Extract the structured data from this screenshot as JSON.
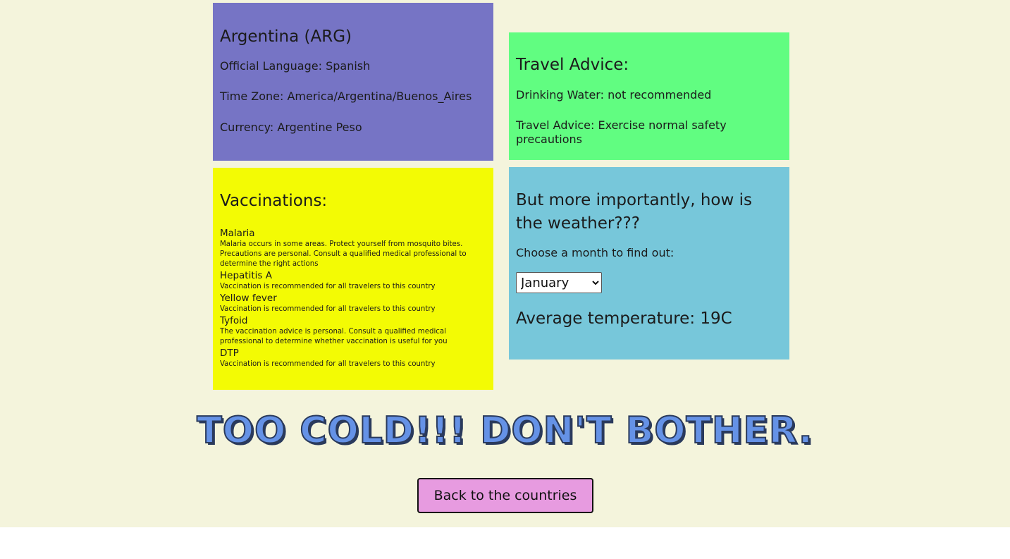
{
  "country": {
    "title": "Argentina (ARG)",
    "language": "Official Language: Spanish",
    "timezone": "Time Zone: America/Argentina/Buenos_Aires",
    "currency": "Currency: Argentine Peso"
  },
  "advice": {
    "heading": "Travel Advice:",
    "drinking_water": "Drinking Water: not recommended",
    "travel_advice": "Travel Advice: Exercise normal safety precautions"
  },
  "vaccinations": {
    "heading": "Vaccinations:",
    "items": [
      {
        "name": "Malaria",
        "description": "Malaria occurs in some areas. Protect yourself from mosquito bites. Precautions are personal. Consult a qualified medical professional to determine the right actions"
      },
      {
        "name": "Hepatitis A",
        "description": "Vaccination is recommended for all travelers to this country"
      },
      {
        "name": "Yellow fever",
        "description": "Vaccination is recommended for all travelers to this country"
      },
      {
        "name": "Tyfoid",
        "description": "The vaccination advice is personal. Consult a qualified medical professional to determine whether vaccination is useful for you"
      },
      {
        "name": "DTP",
        "description": "Vaccination is recommended for all travelers to this country"
      }
    ]
  },
  "weather": {
    "heading": "But more importantly, how is the weather???",
    "prompt": "Choose a month to find out:",
    "selected_month": "January",
    "temperature": "Average temperature: 19C"
  },
  "verdict": "Too cold!!! Don't bother.",
  "back_button": "Back to the countries",
  "colors": {
    "background": "#f4f4dc",
    "country_card": "#7674c5",
    "advice_card": "#61fd81",
    "vaccination_card": "#f3fb04",
    "weather_card": "#77c7da",
    "verdict_text": "#6592e6",
    "back_button": "#e79be0"
  }
}
